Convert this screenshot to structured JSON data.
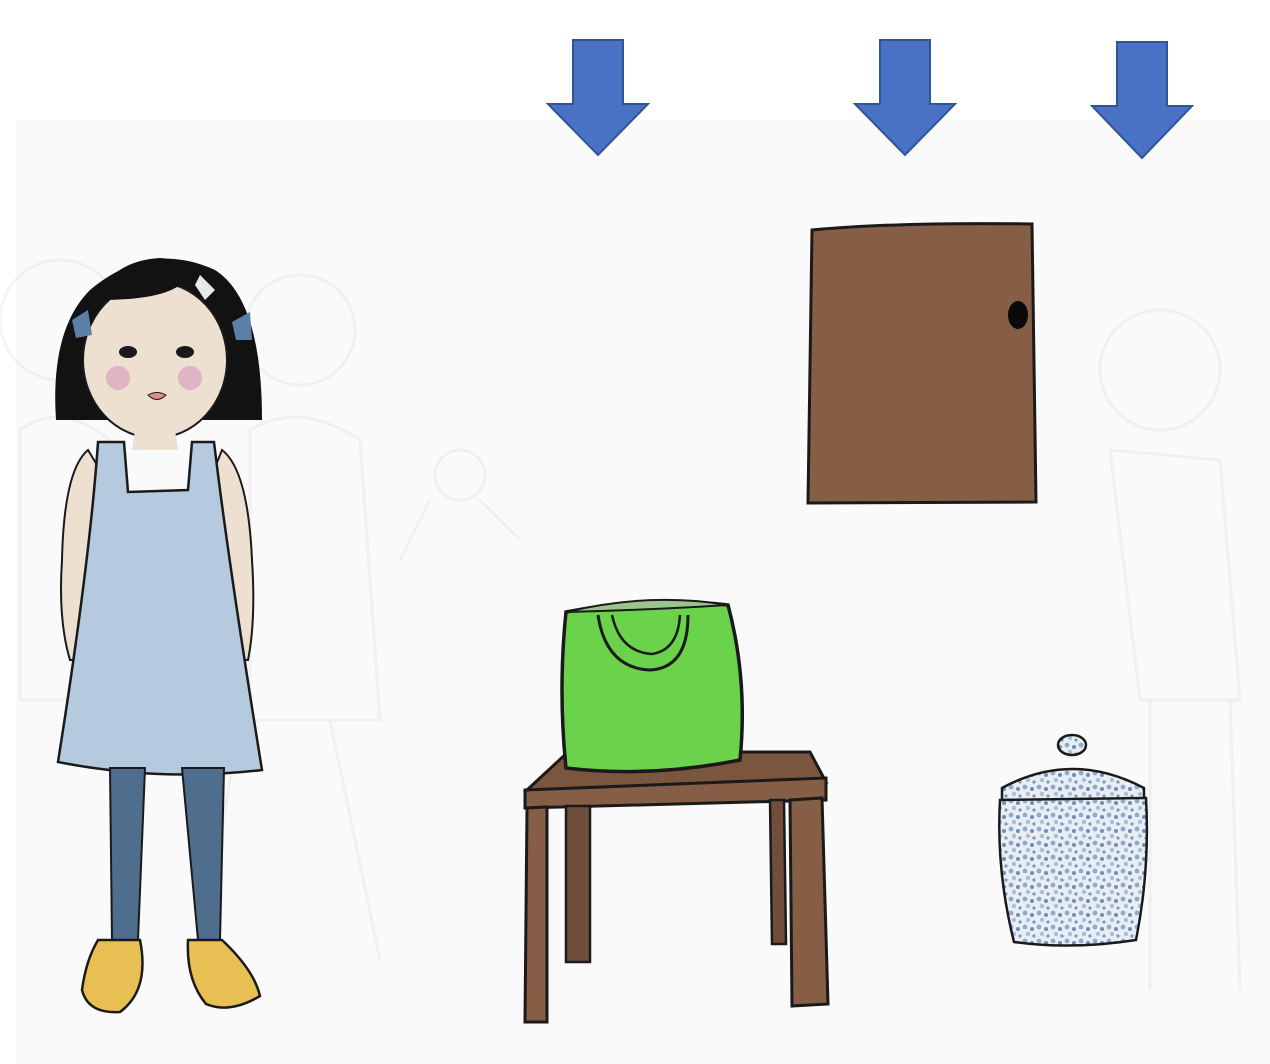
{
  "scene": {
    "description_colors": {
      "arrow": "#4A72C4",
      "door": "#855E45",
      "bag": "#6BD34B",
      "table": "#855E45",
      "dress": "#B5C9DF",
      "leggings": "#4F6E8E",
      "shoes": "#E7BF53",
      "hair": "#121212",
      "jar": "#9CB6D2"
    },
    "arrows": [
      {
        "target": "empty-spot"
      },
      {
        "target": "door"
      },
      {
        "target": "jar"
      }
    ],
    "objects": [
      "girl",
      "door",
      "bag",
      "table",
      "jar"
    ]
  }
}
